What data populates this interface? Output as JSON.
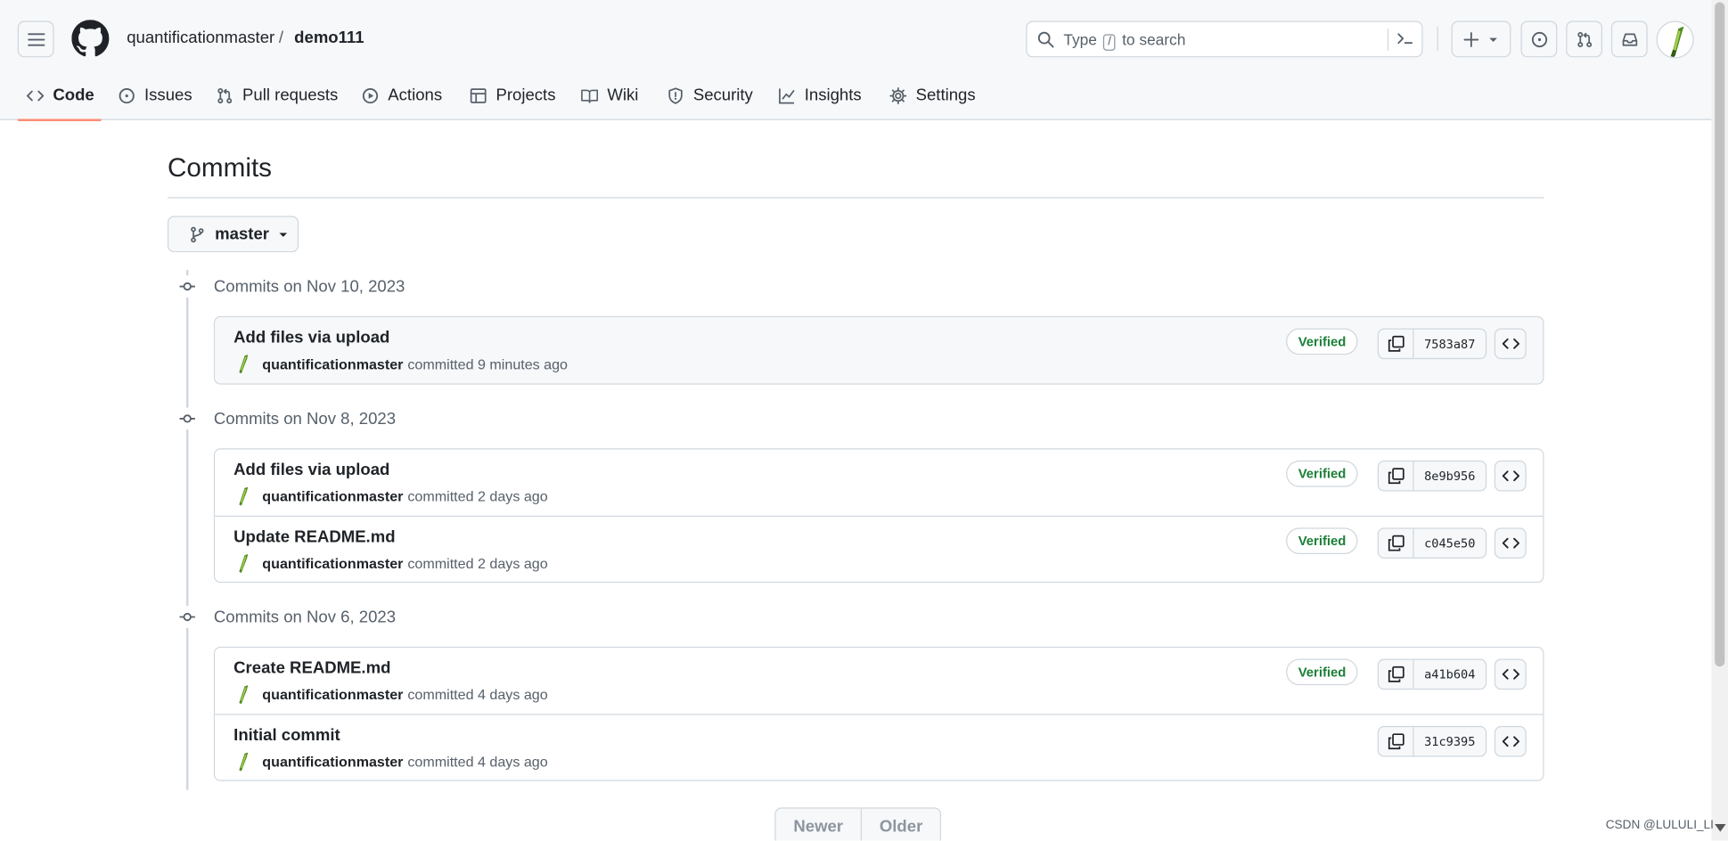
{
  "header": {
    "owner": "quantificationmaster",
    "separator": "/",
    "repo": "demo111",
    "search": {
      "prefix": "Type",
      "key": "/",
      "suffix": "to search"
    }
  },
  "tabs": [
    {
      "label": "Code",
      "icon": "code-icon",
      "active": true
    },
    {
      "label": "Issues",
      "icon": "issue-opened-icon"
    },
    {
      "label": "Pull requests",
      "icon": "git-pull-request-icon"
    },
    {
      "label": "Actions",
      "icon": "play-icon"
    },
    {
      "label": "Projects",
      "icon": "table-icon"
    },
    {
      "label": "Wiki",
      "icon": "book-icon"
    },
    {
      "label": "Security",
      "icon": "shield-icon"
    },
    {
      "label": "Insights",
      "icon": "graph-icon"
    },
    {
      "label": "Settings",
      "icon": "gear-icon"
    }
  ],
  "page": {
    "title": "Commits",
    "branch": "master"
  },
  "groups": [
    {
      "date": "Commits on Nov 10, 2023",
      "commits": [
        {
          "message": "Add files via upload",
          "author": "quantificationmaster",
          "verb": "committed",
          "time": "9 minutes ago",
          "verified": "Verified",
          "sha": "7583a87"
        }
      ]
    },
    {
      "date": "Commits on Nov 8, 2023",
      "commits": [
        {
          "message": "Add files via upload",
          "author": "quantificationmaster",
          "verb": "committed",
          "time": "2 days ago",
          "verified": "Verified",
          "sha": "8e9b956"
        },
        {
          "message": "Update README.md",
          "author": "quantificationmaster",
          "verb": "committed",
          "time": "2 days ago",
          "verified": "Verified",
          "sha": "c045e50"
        }
      ]
    },
    {
      "date": "Commits on Nov 6, 2023",
      "commits": [
        {
          "message": "Create README.md",
          "author": "quantificationmaster",
          "verb": "committed",
          "time": "4 days ago",
          "verified": "Verified",
          "sha": "a41b604"
        },
        {
          "message": "Initial commit",
          "author": "quantificationmaster",
          "verb": "committed",
          "time": "4 days ago",
          "verified": "",
          "sha": "31c9395"
        }
      ]
    }
  ],
  "pager": {
    "newer": "Newer",
    "older": "Older"
  },
  "watermark": "CSDN @LULULI_LI",
  "colors": {
    "accent_underline": "#fd8c73",
    "verified_green": "#1a7f37",
    "border": "#d0d7de"
  }
}
